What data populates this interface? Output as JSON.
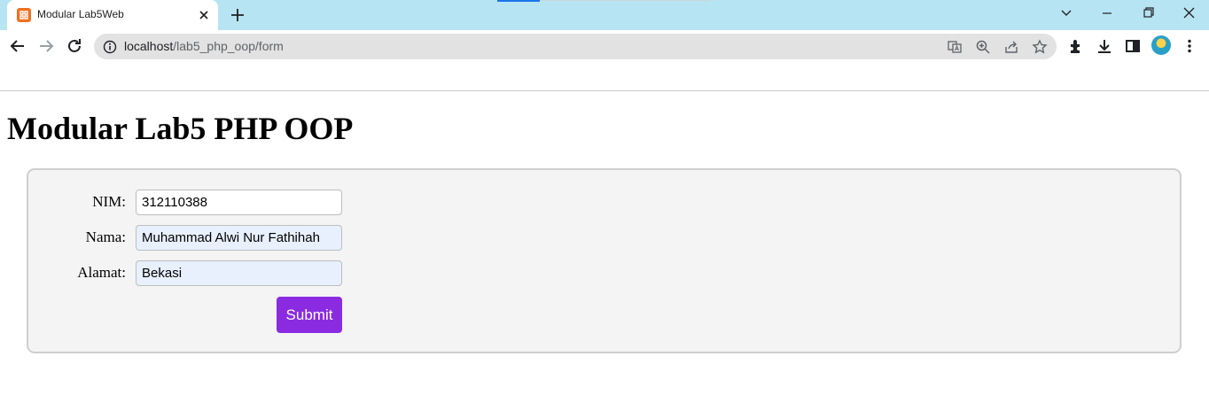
{
  "browser": {
    "tab": {
      "title": "Modular Lab5Web"
    },
    "url": {
      "host": "localhost",
      "path": "/lab5_php_oop/form"
    }
  },
  "page": {
    "title": "Modular Lab5 PHP OOP",
    "form": {
      "fields": [
        {
          "label": "NIM:",
          "value": "312110388"
        },
        {
          "label": "Nama:",
          "value": "Muhammad Alwi Nur Fathihah"
        },
        {
          "label": "Alamat:",
          "value": "Bekasi"
        }
      ],
      "submit_label": "Submit"
    }
  },
  "colors": {
    "tabstrip": "#b7e4f2",
    "submit": "#8a2be2",
    "autofill": "#e8f0fe"
  }
}
